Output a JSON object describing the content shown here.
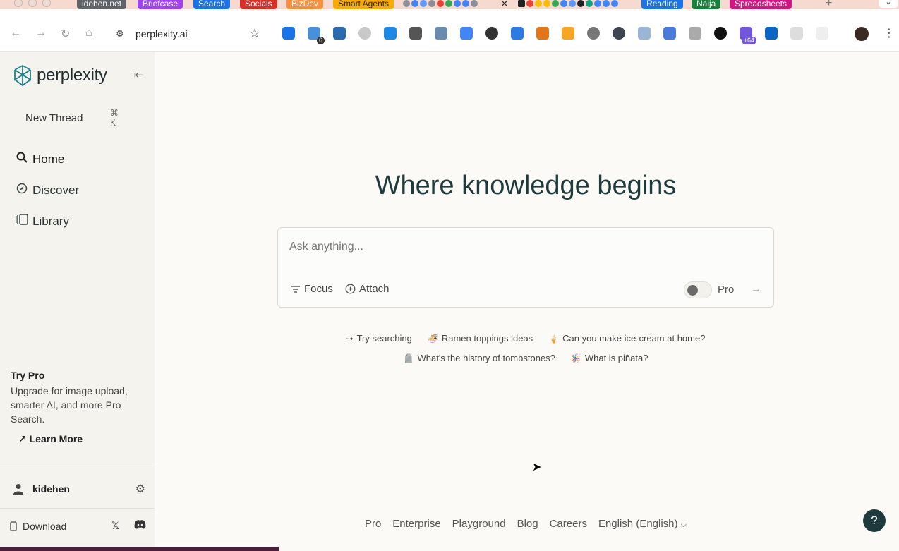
{
  "browser": {
    "tab_groups": [
      {
        "label": "idehen.net",
        "color": "#5f6368"
      },
      {
        "label": "Briefcase",
        "color": "#a142f4"
      },
      {
        "label": "Search",
        "color": "#1a73e8"
      },
      {
        "label": "Socials",
        "color": "#d93025"
      },
      {
        "label": "BizDev",
        "color": "#fa903e"
      },
      {
        "label": "Smart Agents",
        "color": "#f9ab00"
      },
      {
        "label": "Reading",
        "color": "#1a73e8"
      },
      {
        "label": "Naija",
        "color": "#188038"
      },
      {
        "label": "Spreadsheets",
        "color": "#d01884"
      }
    ],
    "active_tab_close": "✕",
    "new_tab": "+",
    "tab_menu": "⌄",
    "url": "perplexity.ai",
    "extension_badges": {
      "first": "6",
      "second": "+64"
    }
  },
  "sidebar": {
    "logo_text": "perplexity",
    "collapse_icon": "⇤",
    "new_thread_label": "New Thread",
    "new_thread_shortcut": "⌘ K",
    "nav": [
      {
        "label": "Home",
        "icon": "search-icon"
      },
      {
        "label": "Discover",
        "icon": "compass-icon"
      },
      {
        "label": "Library",
        "icon": "library-icon"
      }
    ],
    "try_pro_title": "Try Pro",
    "try_pro_desc": "Upgrade for image upload, smarter AI, and more Pro Search.",
    "learn_more": "Learn More",
    "username": "kidehen",
    "download_label": "Download"
  },
  "main": {
    "title": "Where knowledge begins",
    "search_placeholder": "Ask anything...",
    "focus_label": "Focus",
    "attach_label": "Attach",
    "pro_label": "Pro",
    "suggestions_row1": [
      {
        "emoji": "⇢",
        "label": "Try searching"
      },
      {
        "emoji": "🍜",
        "label": "Ramen toppings ideas"
      },
      {
        "emoji": "🍦",
        "label": "Can you make ice-cream at home?"
      }
    ],
    "suggestions_row2": [
      {
        "emoji": "🪦",
        "label": "What's the history of tombstones?"
      },
      {
        "emoji": "🪅",
        "label": "What is piñata?"
      }
    ]
  },
  "footer": {
    "links": [
      "Pro",
      "Enterprise",
      "Playground",
      "Blog",
      "Careers"
    ],
    "language": "English (English)"
  },
  "help_label": "?",
  "colors": {
    "background": "#fbfaf7",
    "sidebar": "#f4f3ee",
    "brand": "#1f3a3c",
    "logo_accent": "#20808d"
  }
}
